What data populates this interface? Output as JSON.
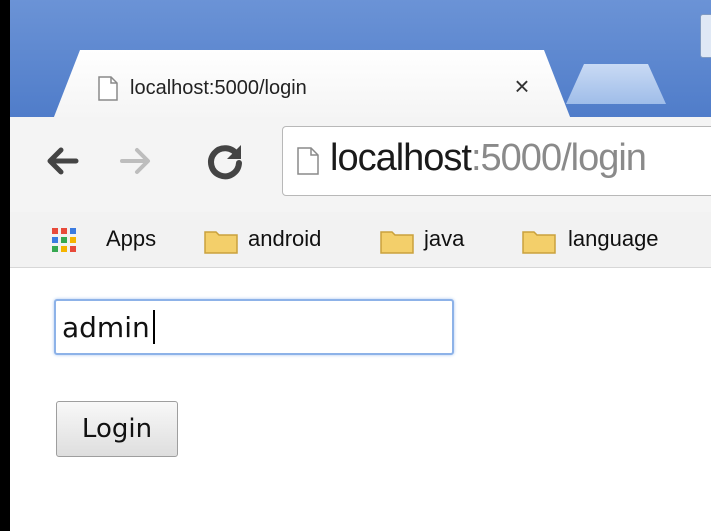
{
  "tab": {
    "title": "localhost:5000/login",
    "close_glyph": "×",
    "page_icon": "page-icon",
    "close_icon": "close-icon"
  },
  "toolbar": {
    "back_icon": "arrow-left-icon",
    "forward_icon": "arrow-right-icon",
    "reload_icon": "reload-icon",
    "address_host": "localhost",
    "address_path": ":5000/login"
  },
  "bookmarks": {
    "items": [
      {
        "label": "Apps",
        "icon": "apps-grid-icon"
      },
      {
        "label": "android",
        "icon": "folder-icon"
      },
      {
        "label": "java",
        "icon": "folder-icon"
      },
      {
        "label": "language",
        "icon": "folder-icon"
      }
    ]
  },
  "form": {
    "username_value": "admin",
    "login_label": "Login"
  },
  "colors": {
    "tabstrip": "#5a86cf",
    "focus_ring": "#8db2e8",
    "folder": "#f3cf6a"
  }
}
